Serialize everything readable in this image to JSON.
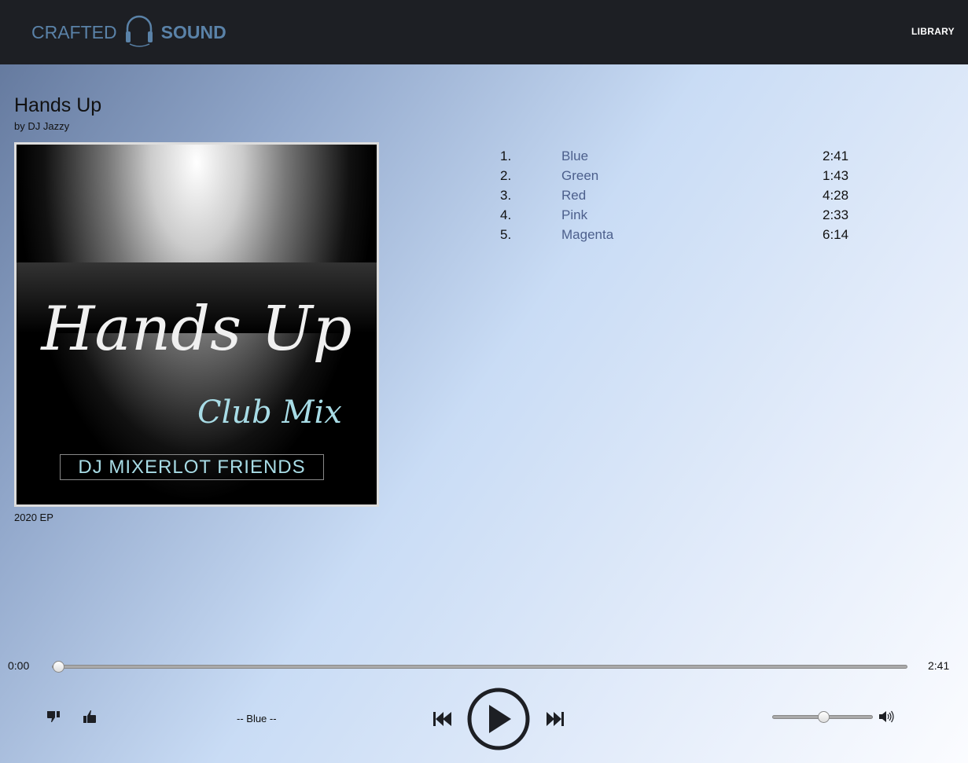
{
  "header": {
    "logo_left": "CRAFTED",
    "logo_right": "SOUND",
    "nav_library": "LIBRARY"
  },
  "album": {
    "title": "Hands Up",
    "artist": "by DJ Jazzy",
    "release": "2020 EP",
    "cover_text": {
      "title": "Hands Up",
      "subtitle": "Club Mix",
      "artist": "DJ MIXERLOT  FRIENDS"
    }
  },
  "tracks": [
    {
      "num": "1.",
      "title": "Blue",
      "duration": "2:41"
    },
    {
      "num": "2.",
      "title": "Green",
      "duration": "1:43"
    },
    {
      "num": "3.",
      "title": "Red",
      "duration": "4:28"
    },
    {
      "num": "4.",
      "title": "Pink",
      "duration": "2:33"
    },
    {
      "num": "5.",
      "title": "Magenta",
      "duration": "6:14"
    }
  ],
  "player": {
    "current_time": "0:00",
    "total_time": "2:41",
    "now_playing": "-- Blue --",
    "progress": 0,
    "volume": 0.5
  }
}
